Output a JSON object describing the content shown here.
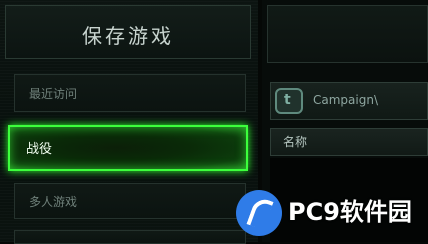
{
  "dialog": {
    "title": "保存游戏",
    "categories": {
      "recent_label": "最近访问",
      "campaign_label": "战役",
      "multiplayer_label": "多人游戏"
    }
  },
  "browser": {
    "path": "Campaign\\",
    "column_name": "名称"
  },
  "watermark": {
    "text": "PC9软件园"
  },
  "colors": {
    "accent_green": "#3cff3c",
    "watermark_blue": "#2f7ce8"
  }
}
